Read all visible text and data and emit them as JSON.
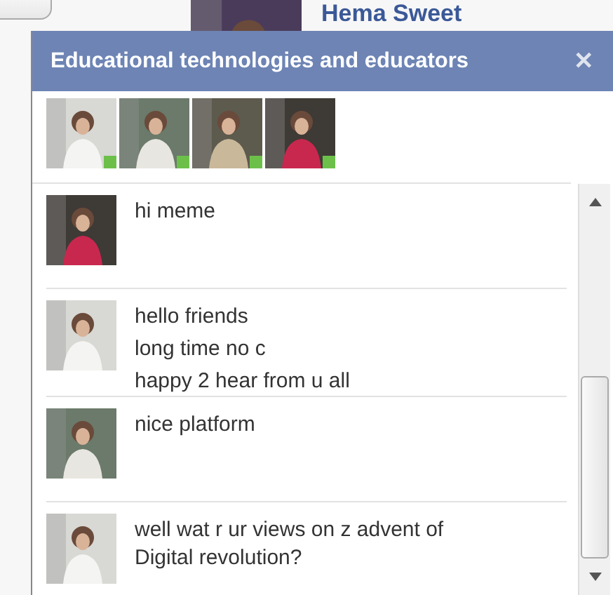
{
  "background": {
    "profile_name": "Hema Sweet"
  },
  "chat": {
    "title": "Educational technologies and educators",
    "close": "✕",
    "participants": [
      {
        "online": true
      },
      {
        "online": true
      },
      {
        "online": true
      },
      {
        "online": true
      }
    ],
    "messages": [
      {
        "lines": [
          "hi meme"
        ]
      },
      {
        "lines": [
          "hello friends",
          "long time no c",
          "happy 2 hear from u all"
        ]
      },
      {
        "lines": [
          "nice platform"
        ]
      },
      {
        "lines": [
          "well wat r ur views on z advent of Digital revolution?"
        ]
      }
    ]
  }
}
